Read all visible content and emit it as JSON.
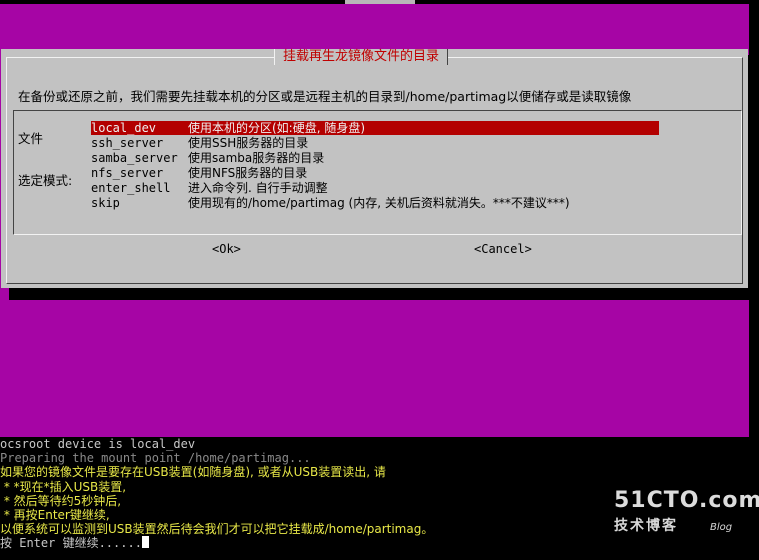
{
  "dialog": {
    "title": "挂载再生龙镜像文件的目录",
    "prompt_lines": [
      "在备份或还原之前，我们需要先挂载本机的分区或是远程主机的目录到/home/partimag以便储存或是读取镜像",
      "文件",
      "选定模式:"
    ],
    "menu": [
      {
        "tag": "local_dev",
        "desc": "使用本机的分区(如:硬盘, 随身盘)",
        "selected": true
      },
      {
        "tag": "ssh_server",
        "desc": "使用SSH服务器的目录",
        "selected": false
      },
      {
        "tag": "samba_server",
        "desc": "使用samba服务器的目录",
        "selected": false
      },
      {
        "tag": "nfs_server",
        "desc": "使用NFS服务器的目录",
        "selected": false
      },
      {
        "tag": "enter_shell",
        "desc": "进入命令列. 自行手动调整",
        "selected": false
      },
      {
        "tag": "skip",
        "desc": "使用现有的/home/partimag (内存, 关机后资料就消失。***不建议***)",
        "selected": false
      }
    ],
    "ok_label": "<Ok>",
    "cancel_label": "<Cancel>"
  },
  "terminal": {
    "lines": [
      {
        "text": "ocsroot device is local_dev",
        "style": "gray"
      },
      {
        "text": "Preparing the mount point /home/partimag...",
        "style": "dim"
      },
      {
        "text": "如果您的镜像文件是要存在USB装置(如随身盘), 或者从USB装置读出, 请",
        "style": "yellow"
      },
      {
        "text": " * *现在*插入USB装置,",
        "style": "yellow"
      },
      {
        "text": " * 然后等待约5秒钟后,",
        "style": "yellow"
      },
      {
        "text": " * 再按Enter键继续,",
        "style": "yellow"
      },
      {
        "text": "以便系统可以监测到USB装置然后待会我们才可以把它挂载成/home/partimag。",
        "style": "yellow"
      },
      {
        "text": "按 Enter 键继续......",
        "style": "gray"
      }
    ]
  },
  "watermark": {
    "logo": "51CTO.com",
    "subtitle": "技术博客",
    "blog": "Blog"
  },
  "colors": {
    "background": "#a605a5",
    "dialog": "#c2c2c2",
    "selection": "#b30000",
    "title_text": "#c00000",
    "terminal_highlight": "#e8e848"
  }
}
